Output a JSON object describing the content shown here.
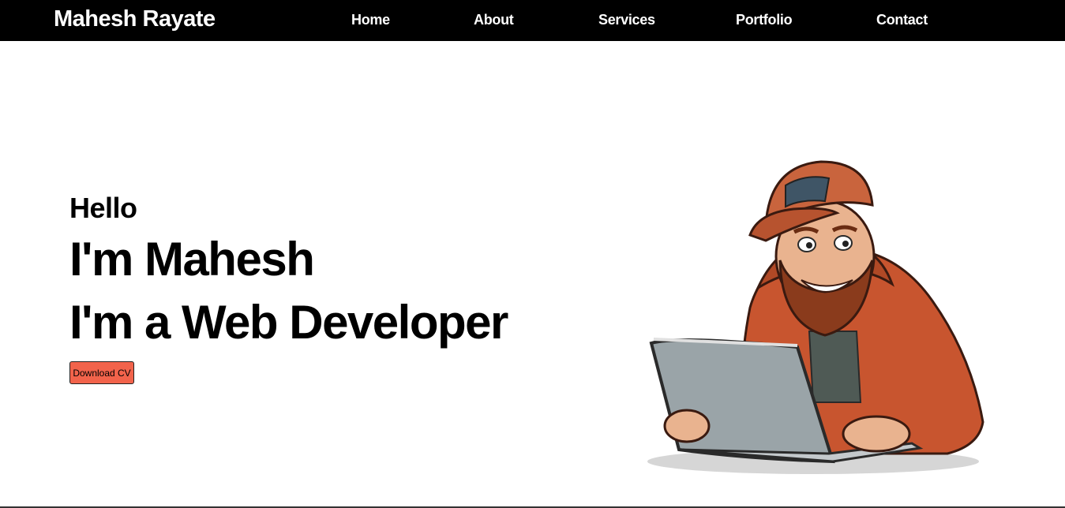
{
  "brand": {
    "name": "Mahesh Rayate"
  },
  "nav": {
    "home": "Home",
    "about": "About",
    "services": "Services",
    "portfolio": "Portfolio",
    "contact": "Contact"
  },
  "hero": {
    "greeting": "Hello",
    "line1": "I'm Mahesh",
    "line2": "I'm a Web Developer",
    "cv_button": "Download CV",
    "illustration_icon": "developer-with-laptop-illustration"
  },
  "colors": {
    "navbar_bg": "#000000",
    "button_bg": "#f2634b",
    "jacket": "#c8552f",
    "cap": "#c9643d",
    "beard": "#8a3b1c",
    "laptop": "#9aa4a8"
  }
}
